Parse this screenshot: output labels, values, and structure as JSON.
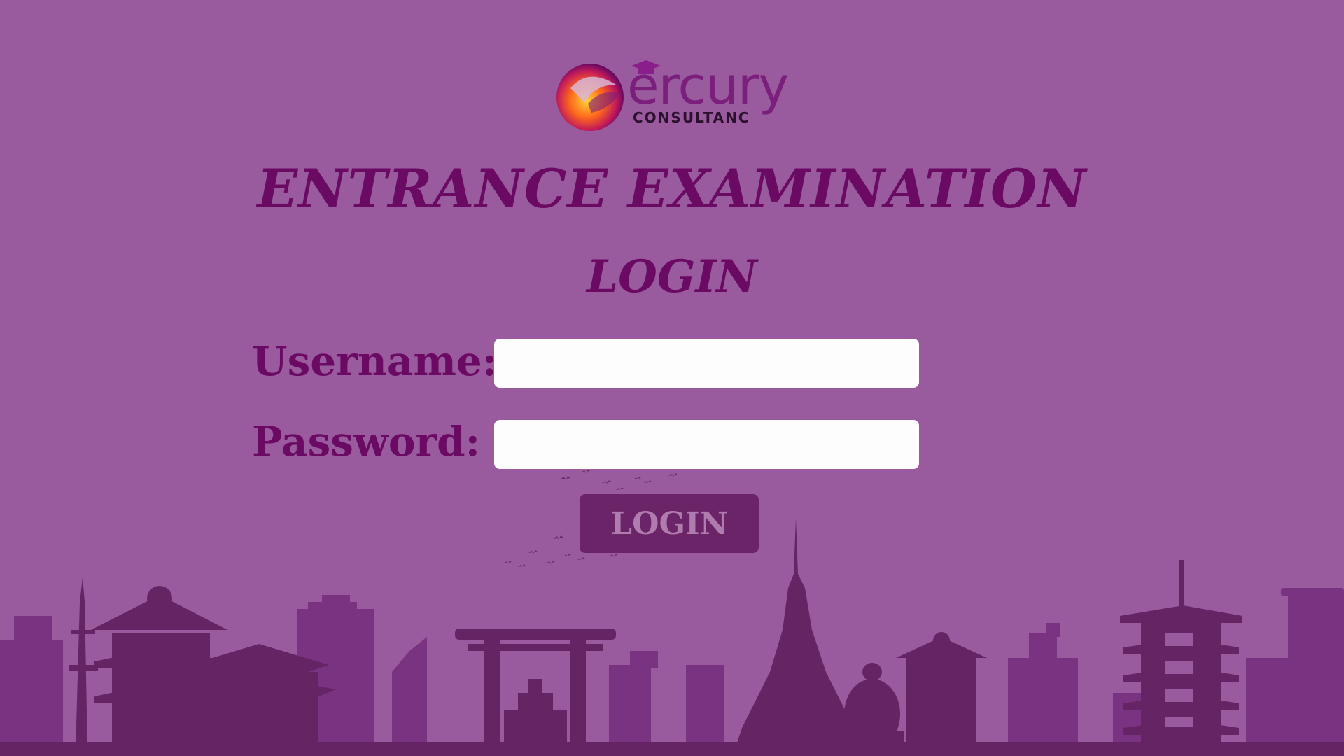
{
  "brand": {
    "logo_word": "ercury",
    "logo_sub": "CONSULTANC"
  },
  "header": {
    "title": "ENTRANCE EXAMINATION",
    "subtitle": "LOGIN"
  },
  "form": {
    "username_label": "Username:",
    "username_value": "",
    "password_label": "Password:",
    "password_value": "",
    "submit_label": "LOGIN"
  },
  "colors": {
    "background": "#9a5b9e",
    "heading": "#6a0a63",
    "button": "#6c2468",
    "button_text": "#b07cb0",
    "skyline_back": "#7a3380",
    "skyline_front": "#652463"
  },
  "icons": {
    "logo_orb": "mercury-orb-icon",
    "logo_cap": "graduation-cap-icon",
    "birds": "birds-icon"
  }
}
